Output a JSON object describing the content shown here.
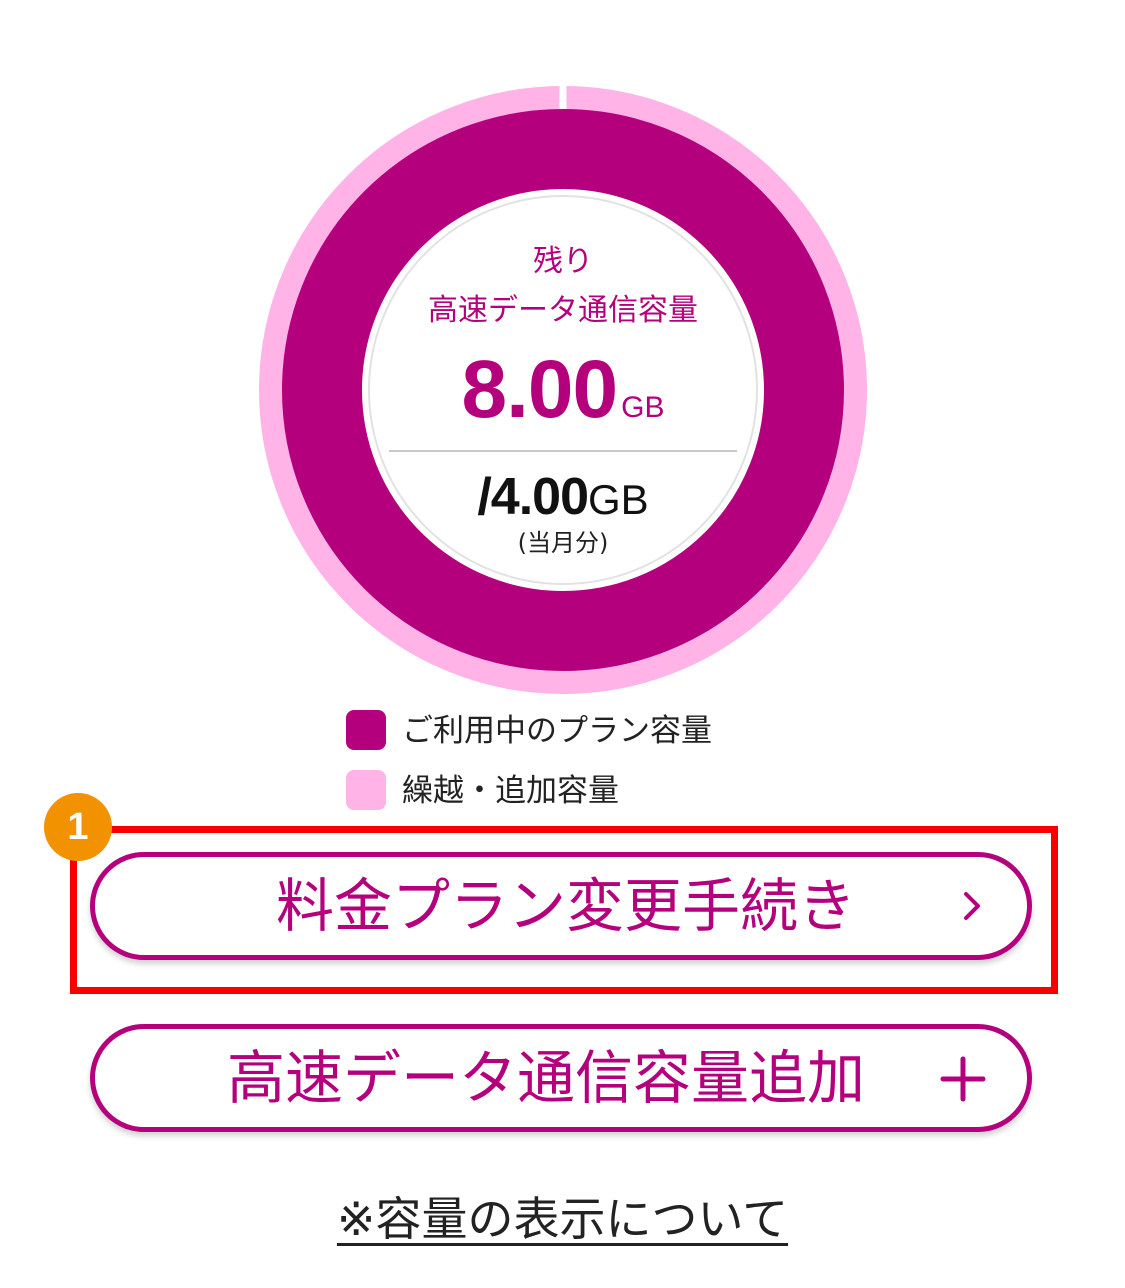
{
  "colors": {
    "plan": "#b4007c",
    "carryover": "#ffb3e6",
    "highlight": "#f80000",
    "badge": "#f39200"
  },
  "gauge": {
    "label_line1": "残り",
    "label_line2": "高速データ通信容量",
    "remaining_value": "8.00",
    "remaining_unit": "GB",
    "total_value": "/4.00",
    "total_unit": "GB",
    "total_note": "(当月分)",
    "plan_fraction": 1.0,
    "carryover_fraction": 1.0
  },
  "legend": [
    {
      "label": "ご利用中のプラン容量",
      "color": "#b4007c"
    },
    {
      "label": "繰越・追加容量",
      "color": "#ffb3e6"
    }
  ],
  "step_badge": "1",
  "buttons": {
    "plan_change": {
      "label": "料金プラン変更手続き",
      "icon": "chevron-right-icon"
    },
    "add_data": {
      "label": "高速データ通信容量追加",
      "icon": "plus-icon"
    }
  },
  "footnote_link": "※容量の表示について"
}
